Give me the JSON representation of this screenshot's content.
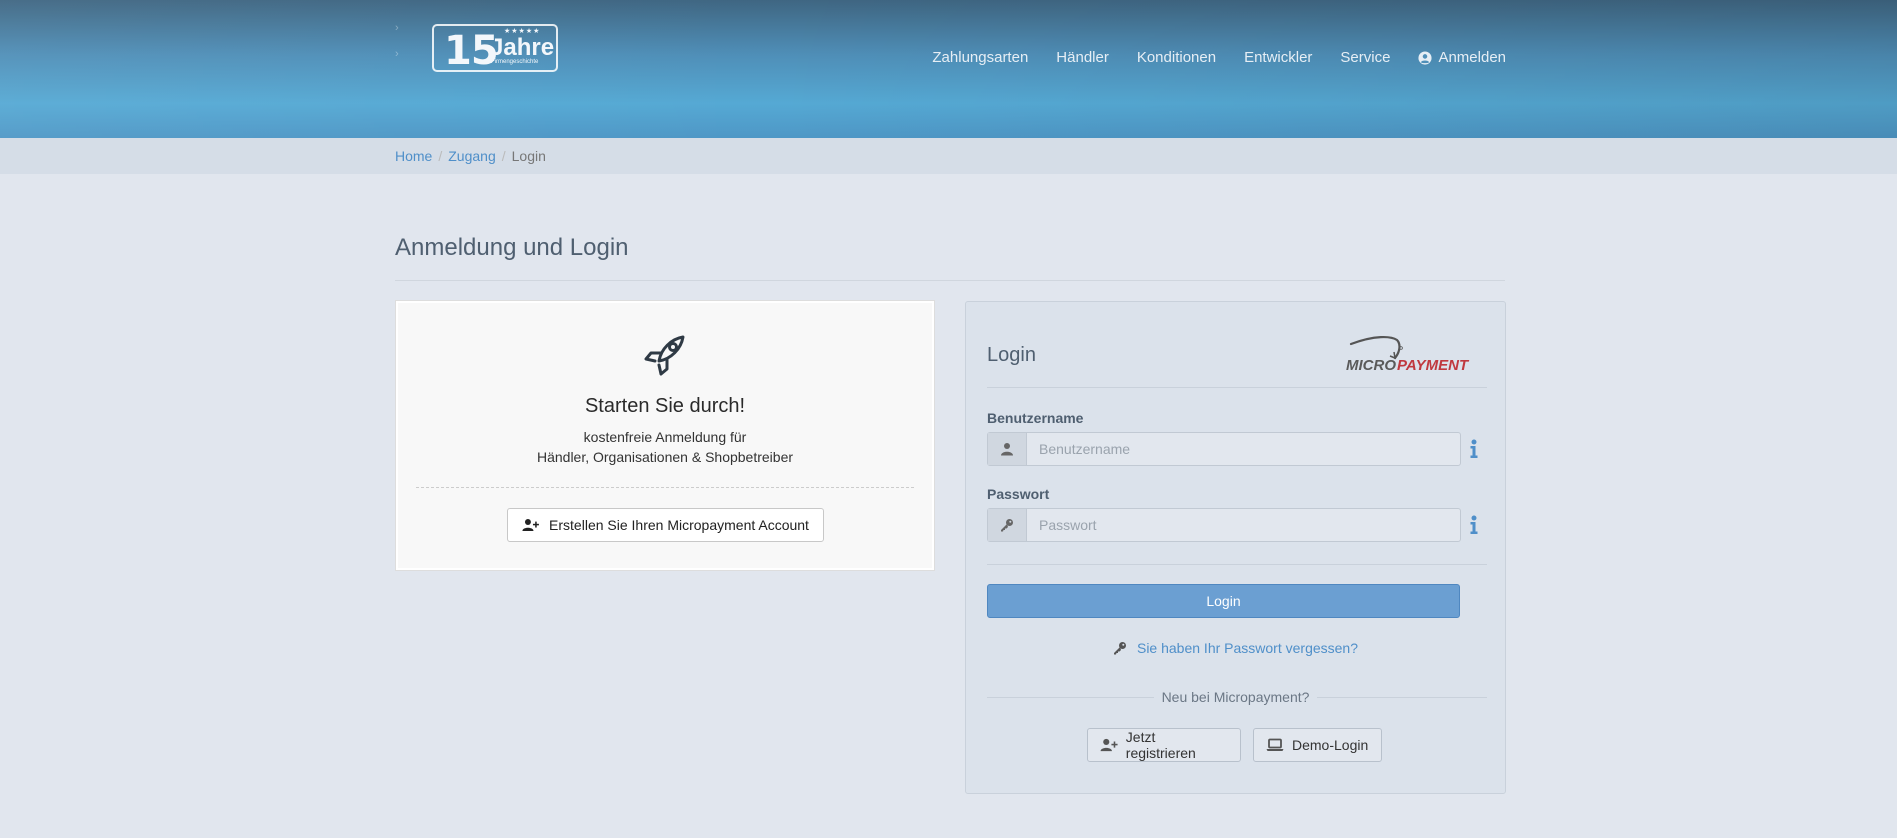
{
  "header": {
    "logo": {
      "number": "15",
      "word": "Jahre",
      "subtitle": "Firmengeschichte",
      "stars": "★★★★★"
    },
    "ghost_marks": [
      "›",
      "›"
    ],
    "nav": [
      {
        "label": "Zahlungsarten"
      },
      {
        "label": "Händler"
      },
      {
        "label": "Konditionen"
      },
      {
        "label": "Entwickler"
      },
      {
        "label": "Service"
      },
      {
        "label": "Anmelden",
        "icon": "user-circle-icon"
      }
    ]
  },
  "breadcrumb": {
    "items": [
      "Home",
      "Zugang",
      "Login"
    ],
    "separator": "/"
  },
  "page": {
    "title": "Anmeldung und Login"
  },
  "signup_card": {
    "icon": "rocket-icon",
    "heading": "Starten Sie durch!",
    "line1": "kostenfreie Anmeldung für",
    "line2": "Händler, Organisationen & Shopbetreiber",
    "button_label": "Erstellen Sie Ihren Micropayment Account"
  },
  "login_card": {
    "heading": "Login",
    "brand": {
      "part1": "MICRO",
      "part2": "PAYMENT",
      "color1": "#5a5a5a",
      "color2": "#c0393f"
    },
    "username": {
      "label": "Benutzername",
      "placeholder": "Benutzername",
      "value": ""
    },
    "password": {
      "label": "Passwort",
      "placeholder": "Passwort",
      "value": ""
    },
    "login_button": "Login",
    "forgot_link": "Sie haben Ihr Passwort vergessen?",
    "new_text": "Neu bei Micropayment?",
    "register_button": "Jetzt registrieren",
    "demo_button": "Demo-Login"
  },
  "colors": {
    "accent": "#6b9fd2",
    "link": "#4f8fc9",
    "title": "#4f5f70",
    "brand_red": "#c0393f"
  }
}
